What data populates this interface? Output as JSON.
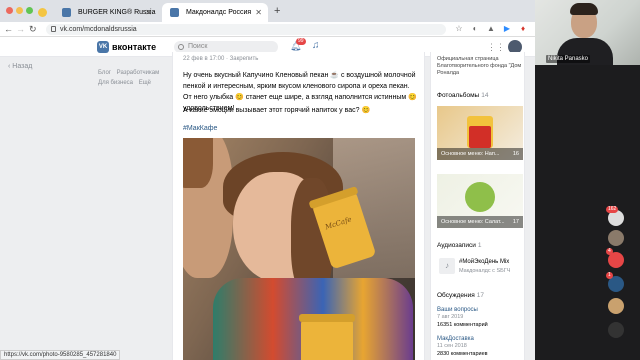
{
  "browser": {
    "tabs": [
      {
        "label": "BURGER KING® Russia",
        "active": false
      },
      {
        "label": "Макдоналдс Россия",
        "active": true
      }
    ],
    "url": "vk.com/mcdonaldsrussia",
    "status_url": "https://vk.com/photo-9580285_457281840"
  },
  "webcam": {
    "name": "Nikita Panasko"
  },
  "vk": {
    "logo_text": "вконтакте",
    "search_placeholder": "Поиск",
    "notif_count": "99",
    "nav_back": "Назад",
    "footer_links": [
      "Блог",
      "Разработчикам",
      "Для бизнеса",
      "Ещё"
    ]
  },
  "post": {
    "meta": "22 фев в 17:00 · Закрепить",
    "text": "Ну очень вкусный Капучино Кленовый пекан ☕ с воздушной молочной пенкой и интересным, ярким вкусом кленового сиропа и ореха пекан. От него улыбка 😊 станет еще шире, а взгляд наполнится истинным 😊 удовольствием!",
    "question": "А какие эмоции вызывает этот горячий напиток у вас? 😊",
    "hashtag": "#МакКафе",
    "cup_label": "McCafe"
  },
  "side": {
    "fund_text": "Официальная страница Благотворительного фонда \"Дом Роналда",
    "albums_label": "Фотоальбомы",
    "albums_count": "14",
    "albums": [
      {
        "title": "Основное меню: Нап...",
        "count": "16"
      },
      {
        "title": "Основное меню: Салат...",
        "count": "17"
      }
    ],
    "audio_label": "Аудиозаписи",
    "audio_count": "1",
    "audio_title": "#МойЭкоДень Mix",
    "audio_sub": "Макдоналдс с SБГЧ",
    "discussions_label": "Обсуждения",
    "discussions_count": "17",
    "topics": [
      {
        "title": "Ваши вопросы",
        "date": "7 авг 2019",
        "comments": "16351 комментарий"
      },
      {
        "title": "МакДоставка",
        "date": "11 сен 2018",
        "comments": "2830 комментариев"
      }
    ]
  },
  "chat_rail": {
    "badges": [
      "162",
      "4",
      "1"
    ]
  },
  "colors": {
    "vk_blue": "#4a76a8",
    "link": "#2a5885",
    "badge_red": "#e64646"
  }
}
